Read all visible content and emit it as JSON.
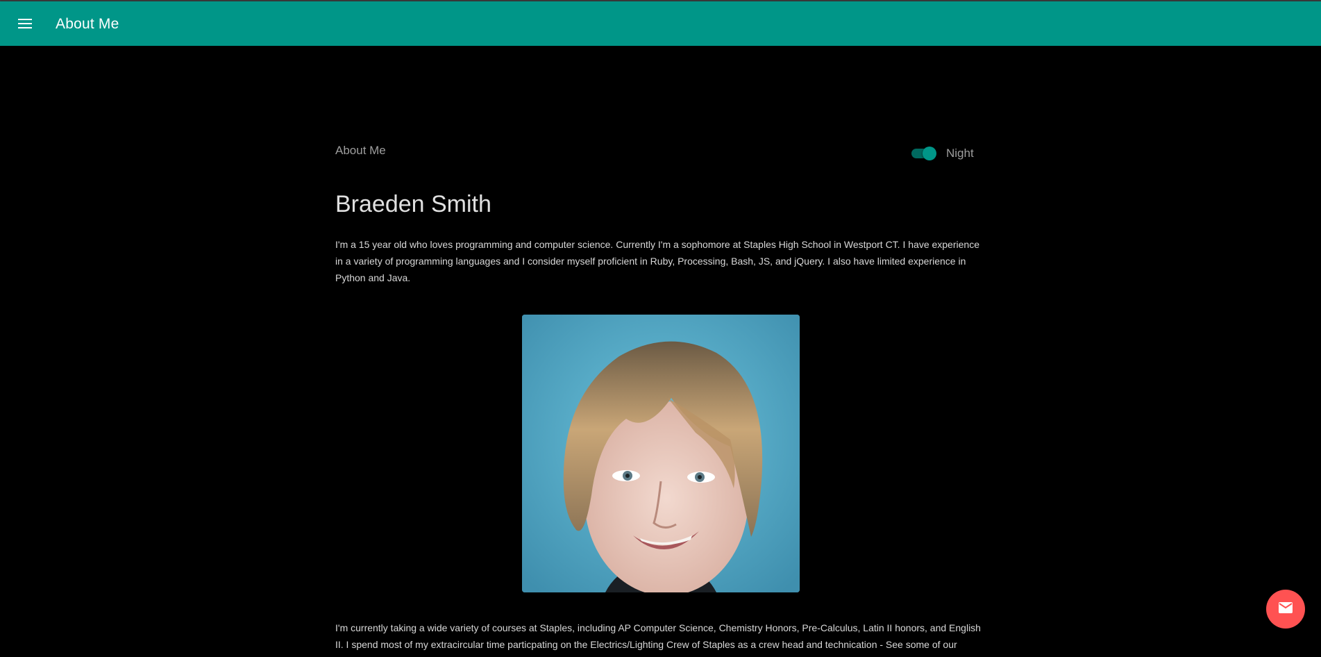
{
  "app_bar": {
    "title": "About Me",
    "menu_icon": "menu-icon",
    "color": "#009688"
  },
  "header": {
    "section_label": "About Me",
    "night_toggle": {
      "label": "Night",
      "checked": true
    }
  },
  "profile": {
    "name": "Braeden Smith",
    "intro": "I'm a 15 year old who loves programming and computer science. Currently I'm a sophomore at Staples High School in Westport CT. I have experience in a variety of programming languages and I consider myself proficient in Ruby, Processing, Bash, JS, and jQuery. I also have limited experience in Python and Java.",
    "courses": "I'm currently taking a wide variety of courses at Staples, including AP Computer Science, Chemistry Honors, Pre-Calculus, Latin II honors, and English II. I spend most of my extracircular time particpating on the Electrics/Lighting Crew of Staples as a crew head and technication - See some of our"
  },
  "fab": {
    "icon": "mail-icon",
    "color": "#ff5252"
  }
}
